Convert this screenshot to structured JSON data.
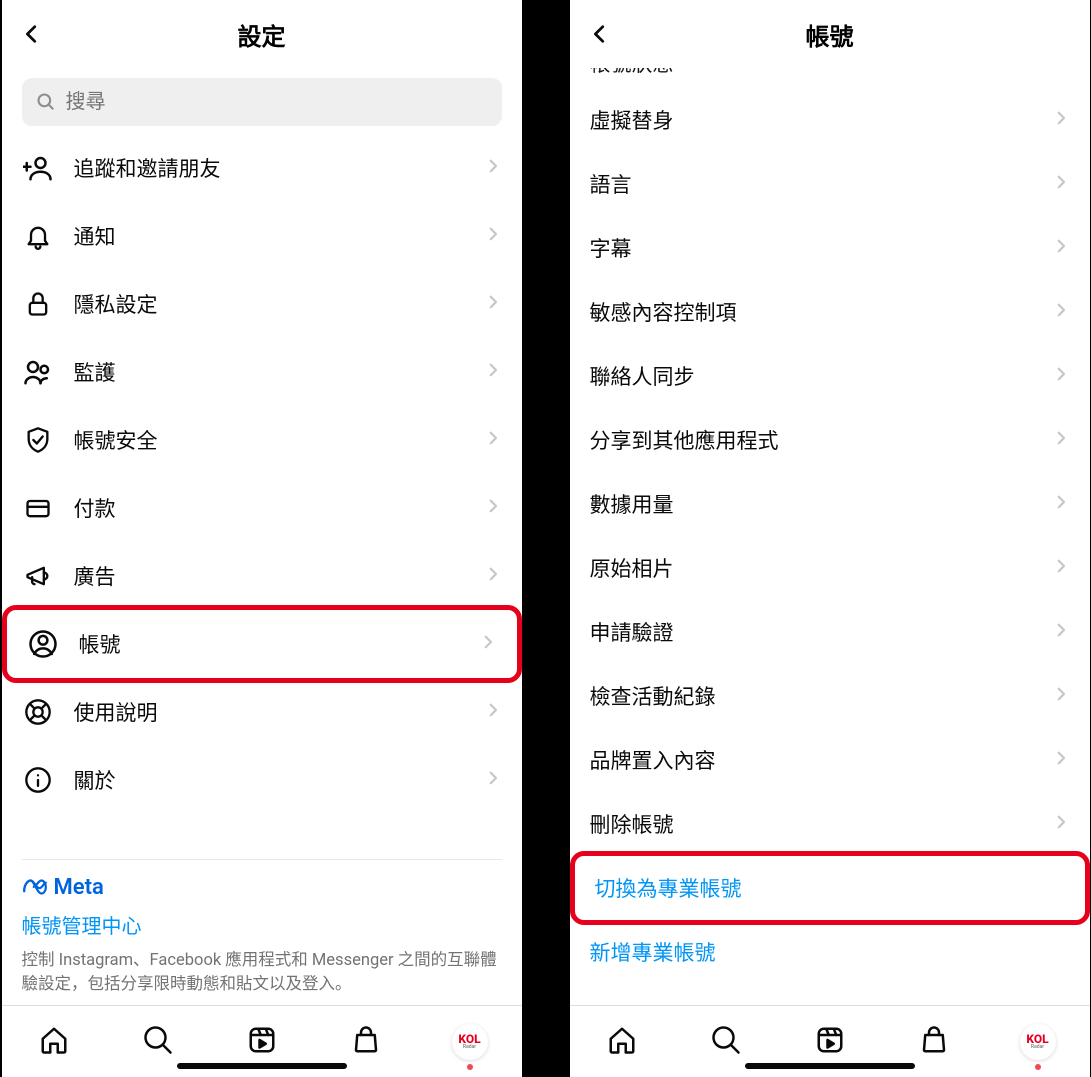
{
  "left": {
    "title": "設定",
    "search_placeholder": "搜尋",
    "items": [
      {
        "icon": "add-person",
        "label": "追蹤和邀請朋友"
      },
      {
        "icon": "bell",
        "label": "通知"
      },
      {
        "icon": "lock",
        "label": "隱私設定"
      },
      {
        "icon": "people",
        "label": "監護"
      },
      {
        "icon": "shield",
        "label": "帳號安全"
      },
      {
        "icon": "card",
        "label": "付款"
      },
      {
        "icon": "megaphone",
        "label": "廣告"
      },
      {
        "icon": "account",
        "label": "帳號",
        "highlight": true
      },
      {
        "icon": "life-ring",
        "label": "使用說明"
      },
      {
        "icon": "info",
        "label": "關於"
      }
    ],
    "meta": {
      "brand": "Meta",
      "link": "帳號管理中心",
      "desc": "控制 Instagram、Facebook 應用程式和 Messenger 之間的互聯體驗設定，包括分享限時動態和貼文以及登入。"
    }
  },
  "right": {
    "title": "帳號",
    "items": [
      {
        "label": "帳號狀態",
        "cut": true
      },
      {
        "label": "虛擬替身"
      },
      {
        "label": "語言"
      },
      {
        "label": "字幕"
      },
      {
        "label": "敏感內容控制項"
      },
      {
        "label": "聯絡人同步"
      },
      {
        "label": "分享到其他應用程式"
      },
      {
        "label": "數據用量"
      },
      {
        "label": "原始相片"
      },
      {
        "label": "申請驗證"
      },
      {
        "label": "檢查活動紀錄"
      },
      {
        "label": "品牌置入內容"
      },
      {
        "label": "刪除帳號"
      },
      {
        "label": "切換為專業帳號",
        "blue": true,
        "nochev": true,
        "highlight": true
      },
      {
        "label": "新增專業帳號",
        "blue": true,
        "nochev": true
      }
    ]
  },
  "avatar_text": "KOL",
  "avatar_sub": "Radar"
}
